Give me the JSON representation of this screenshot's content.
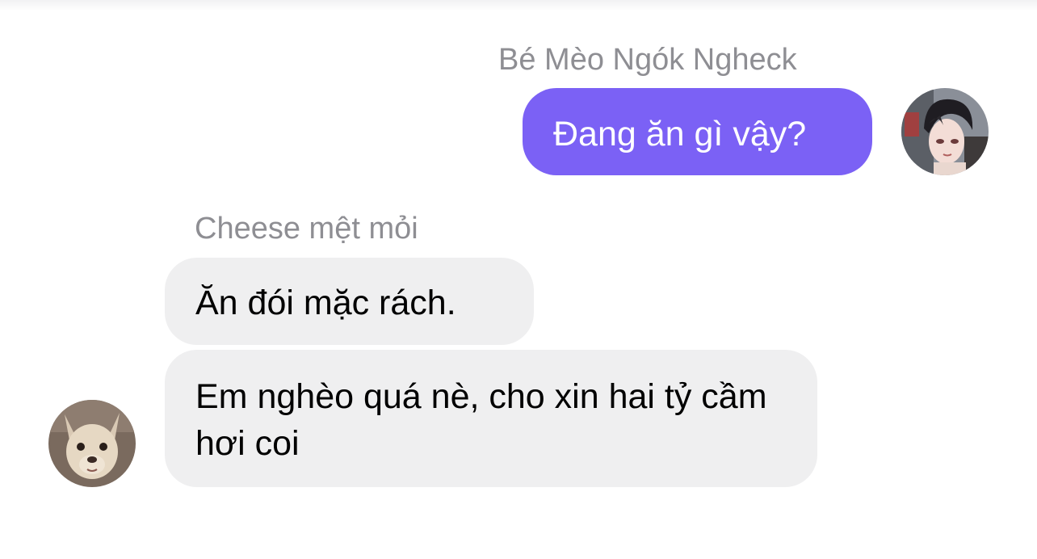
{
  "thread": {
    "outgoing": {
      "sender_name": "Bé Mèo Ngók Ngheck",
      "avatar_icon": "anime-boy-avatar-icon",
      "bubble_color": "#7b61f5",
      "messages": [
        "Đang ăn gì vậy?"
      ]
    },
    "incoming": {
      "sender_name": "Cheese mệt mỏi",
      "avatar_icon": "chihuahua-dog-avatar-icon",
      "bubble_color": "#efeff0",
      "messages": [
        "Ăn đói mặc rách.",
        "Em nghèo quá nè, cho xin hai tỷ cầm hơi coi"
      ]
    }
  }
}
